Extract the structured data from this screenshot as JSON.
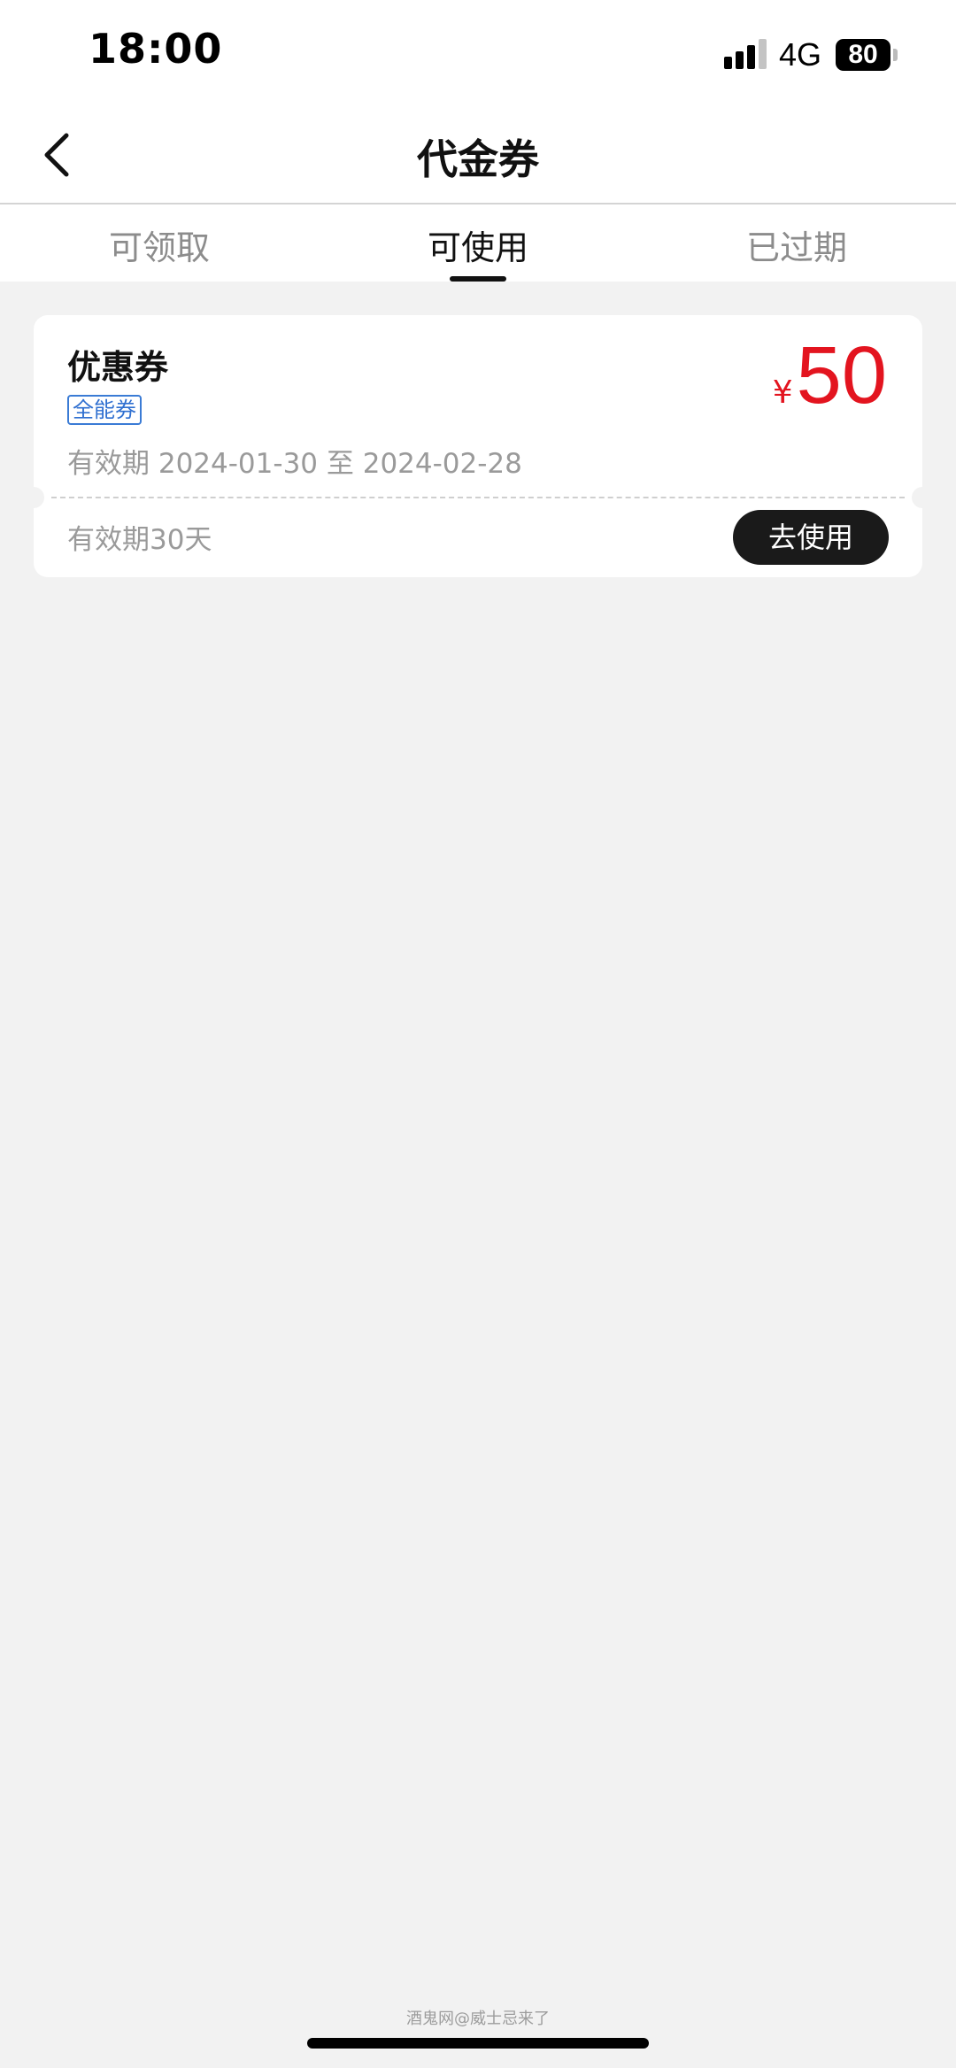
{
  "status_bar": {
    "time": "18:00",
    "network": "4G",
    "battery": "80",
    "signal_icon": "signal-bars-icon"
  },
  "nav": {
    "title": "代金券",
    "back_icon": "chevron-left-icon"
  },
  "tabs": [
    {
      "label": "可领取",
      "active": false
    },
    {
      "label": "可使用",
      "active": true
    },
    {
      "label": "已过期",
      "active": false
    }
  ],
  "coupon": {
    "name": "优惠券",
    "tag": "全能券",
    "validity": "有效期 2024-01-30 至 2024-02-28",
    "currency": "¥",
    "amount": "50",
    "duration": "有效期30天",
    "use_button": "去使用",
    "amount_color": "#e3141f",
    "tag_color": "#2f6fd0"
  },
  "watermark": "酒鬼网@威士忌来了"
}
